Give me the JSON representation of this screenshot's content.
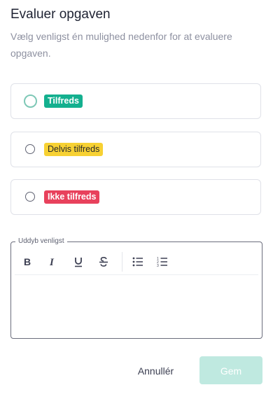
{
  "dialog": {
    "title": "Evaluer opgaven",
    "description": "Vælg venligst én mulighed nedenfor for at evaluere opgaven."
  },
  "options": [
    {
      "label": "Tilfreds",
      "color": "#14b08f",
      "focused": true
    },
    {
      "label": "Delvis tilfreds",
      "color": "#f7d133",
      "focused": false
    },
    {
      "label": "Ikke tilfreds",
      "color": "#e8415c",
      "focused": false
    }
  ],
  "editor": {
    "legend": "Uddyb venligst",
    "toolbar": [
      "bold-icon",
      "italic-icon",
      "underline-icon",
      "strikethrough-icon",
      "bullet-list-icon",
      "numbered-list-icon"
    ],
    "value": ""
  },
  "actions": {
    "cancel_label": "Annullér",
    "save_label": "Gem",
    "save_color": "#bfe9e0"
  }
}
